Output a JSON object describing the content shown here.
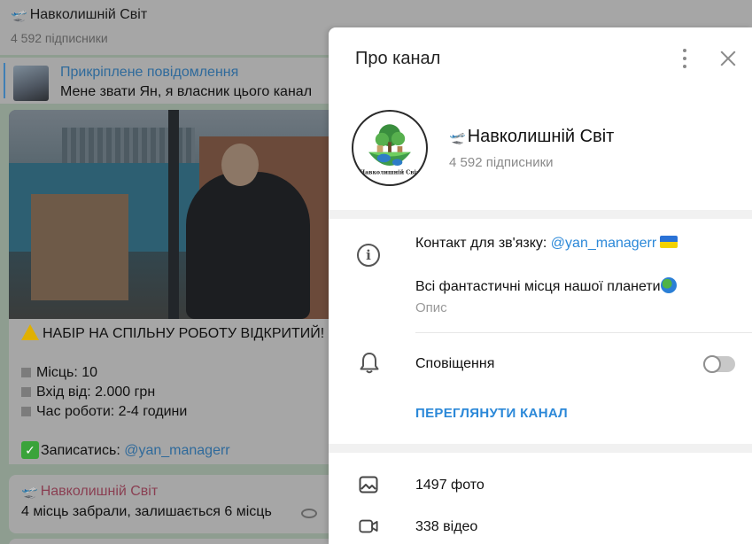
{
  "chat": {
    "title": "Навколишній Світ",
    "subscribers": "4 592 підписники",
    "pinned": {
      "label": "Прикріплене повідомлення",
      "text": "Мене звати Ян, я власник цього канал"
    },
    "message1": {
      "line1": "НАБІР НА СПІЛЬНУ РОБОТУ ВІДКРИТИЙ!",
      "places": "Місць: 10",
      "entry": "Вхід від: 2.000 грн",
      "hours": "Час роботи: 2-4 години",
      "signup_prefix": "Записатись: ",
      "signup_link": "@yan_managerr"
    },
    "message2": {
      "author": "Навколишній Світ",
      "text": "4 місць забрали, залишається 6 місць"
    }
  },
  "panel": {
    "title": "Про канал",
    "channel_name": "Навколишній Світ",
    "subscribers": "4 592 підписники",
    "contact_prefix": "Контакт для зв'язку: ",
    "contact_link": "@yan_managerr",
    "description": "Всі фантастичні місця нашої планети",
    "description_label": "Опис",
    "notifications_label": "Сповіщення",
    "notifications_on": false,
    "view_channel": "ПЕРЕГЛЯНУТИ КАНАЛ",
    "photos": "1497 фото",
    "videos": "338 відео",
    "avatar_caption": "Навколишній Світ"
  },
  "icons": {
    "channel_emoji": "airplane-takeoff-icon",
    "info": "info-icon",
    "bell": "bell-icon",
    "photo": "photo-icon",
    "video": "video-icon",
    "more": "more-vertical-icon",
    "close": "close-icon"
  },
  "colors": {
    "accent": "#2b88d8",
    "toggle_off": "#c8c8c8"
  }
}
